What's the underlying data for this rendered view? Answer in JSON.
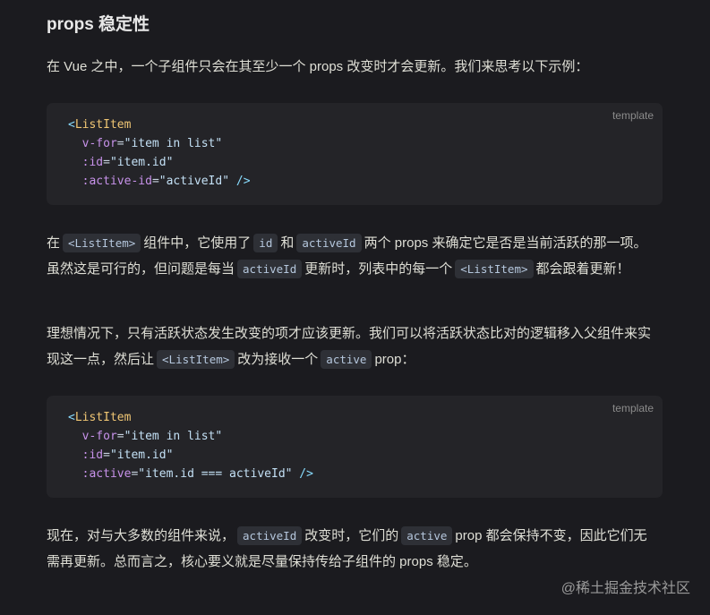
{
  "title": "props 稳定性",
  "p1": "在 Vue 之中，一个子组件只会在其至少一个 props 改变时才会更新。我们来思考以下示例：",
  "code1": {
    "lang": "template",
    "tag": "ListItem",
    "l2a": "v-for",
    "l2b": "\"item in list\"",
    "l3a": ":id",
    "l3b": "\"item.id\"",
    "l4a": ":active-id",
    "l4b": "\"activeId\""
  },
  "p2": {
    "t1": "在",
    "c1": "<ListItem>",
    "t2": "组件中，它使用了",
    "c2": "id",
    "t3": "和",
    "c3": "activeId",
    "t4": "两个 props 来确定它是否是当前活跃的那一项。虽然这是可行的，但问题是每当",
    "c4": "activeId",
    "t5": "更新时，列表中的每一个",
    "c5": "<ListItem>",
    "t6": "都会跟着更新！"
  },
  "p3": {
    "t1": "理想情况下，只有活跃状态发生改变的项才应该更新。我们可以将活跃状态比对的逻辑移入父组件来实现这一点，然后让",
    "c1": "<ListItem>",
    "t2": "改为接收一个",
    "c2": "active",
    "t3": "prop："
  },
  "code2": {
    "lang": "template",
    "tag": "ListItem",
    "l2a": "v-for",
    "l2b": "\"item in list\"",
    "l3a": ":id",
    "l3b": "\"item.id\"",
    "l4a": ":active",
    "l4b": "\"item.id === activeId\""
  },
  "p4": {
    "t1": "现在，对与大多数的组件来说，",
    "c1": "activeId",
    "t2": "改变时，它们的",
    "c2": "active",
    "t3": "prop 都会保持不变，因此它们无需再更新。总而言之，核心要义就是尽量保持传给子组件的 props 稳定。"
  },
  "watermark": "@稀土掘金技术社区"
}
